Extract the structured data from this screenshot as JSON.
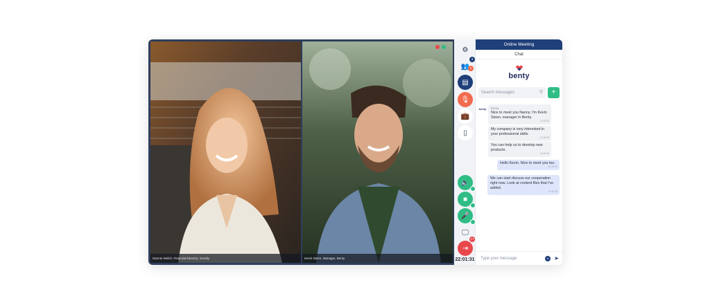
{
  "participants": [
    {
      "caption": "Nannie Welch, Financial Director, Scordy"
    },
    {
      "caption": "Kevin Steen, Manager, Benty"
    }
  ],
  "toolbar": {
    "participants_badge": "3",
    "reactions_badge": "1",
    "leave_badge": "17",
    "timer": "22:01:31",
    "icons": [
      "gear-icon",
      "people-icon",
      "chat-icon",
      "mic-icon",
      "briefcase-icon",
      "document-icon",
      "speaker-icon",
      "camera-icon",
      "mic-icon",
      "screen-icon",
      "exit-icon"
    ]
  },
  "chat": {
    "title": "Online Meeting",
    "subtitle": "Chat",
    "brand": "benty",
    "search_placeholder": "Search messages",
    "add_label": "+",
    "compose_placeholder": "Type your message",
    "avatar_label": "benty",
    "messages": [
      {
        "sender": "Benty",
        "text": "Nice to meet you Nanny. I'm Kevin Steen, manager in Benty.",
        "time": "11:45:36",
        "direction": "in"
      },
      {
        "sender": "",
        "text": "My company is very interested in your professional skills.",
        "time": "11:45:38",
        "direction": "in"
      },
      {
        "sender": "",
        "text": "You can help us to develop new products.",
        "time": "11:45:38",
        "direction": "in"
      },
      {
        "sender": "",
        "text": "Hello Kevin. Nice to meet you too.",
        "time": "11:46:30",
        "direction": "out"
      },
      {
        "sender": "",
        "text": "We can start discuss our cooperation right now. Look at content files that I've added.",
        "time": "11:46:38",
        "direction": "out"
      }
    ]
  },
  "colors": {
    "navy": "#1f3f7a",
    "green": "#2fbd85",
    "orange": "#f26b4f",
    "red": "#e8474c"
  }
}
